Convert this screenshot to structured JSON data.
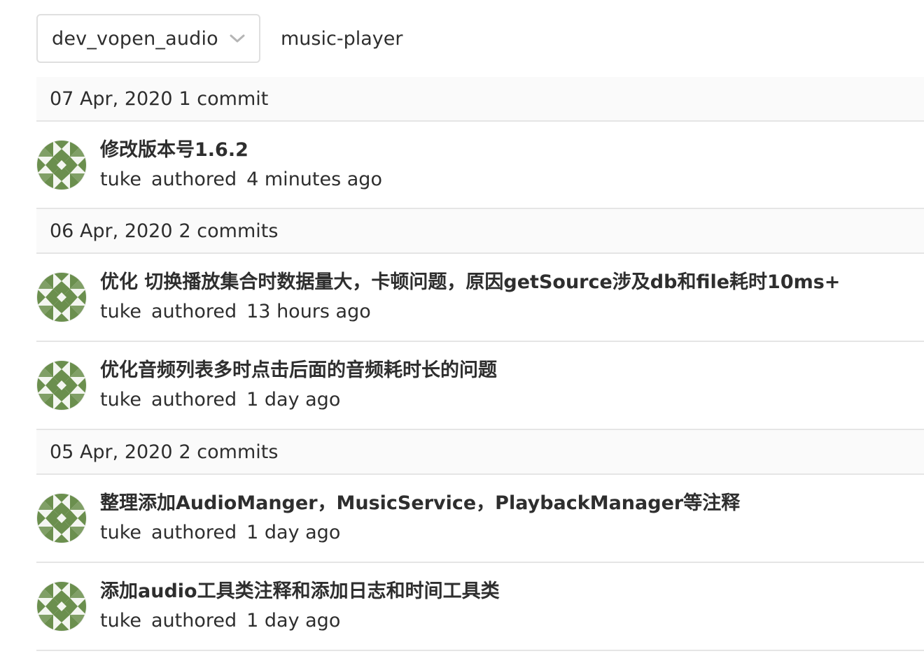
{
  "toolbar": {
    "branch": "dev_vopen_audio",
    "path": "music-player"
  },
  "groups": [
    {
      "date": "07 Apr, 2020",
      "count": "1 commit",
      "commits": [
        {
          "title": "修改版本号1.6.2",
          "author": "tuke",
          "action": "authored",
          "time": "4 minutes ago"
        }
      ]
    },
    {
      "date": "06 Apr, 2020",
      "count": "2 commits",
      "commits": [
        {
          "title": "优化 切换播放集合时数据量大，卡顿问题，原因getSource涉及db和file耗时10ms+",
          "author": "tuke",
          "action": "authored",
          "time": "13 hours ago"
        },
        {
          "title": "优化音频列表多时点击后面的音频耗时长的问题",
          "author": "tuke",
          "action": "authored",
          "time": "1 day ago"
        }
      ]
    },
    {
      "date": "05 Apr, 2020",
      "count": "2 commits",
      "commits": [
        {
          "title": "整理添加AudioManger，MusicService，PlaybackManager等注释",
          "author": "tuke",
          "action": "authored",
          "time": "1 day ago"
        },
        {
          "title": "添加audio工具类注释和添加日志和时间工具类",
          "author": "tuke",
          "action": "authored",
          "time": "1 day ago"
        }
      ]
    }
  ],
  "colors": {
    "avatar_green": "#6b8f4e",
    "header_bg": "#fafafa",
    "border": "#e5e5e5"
  }
}
